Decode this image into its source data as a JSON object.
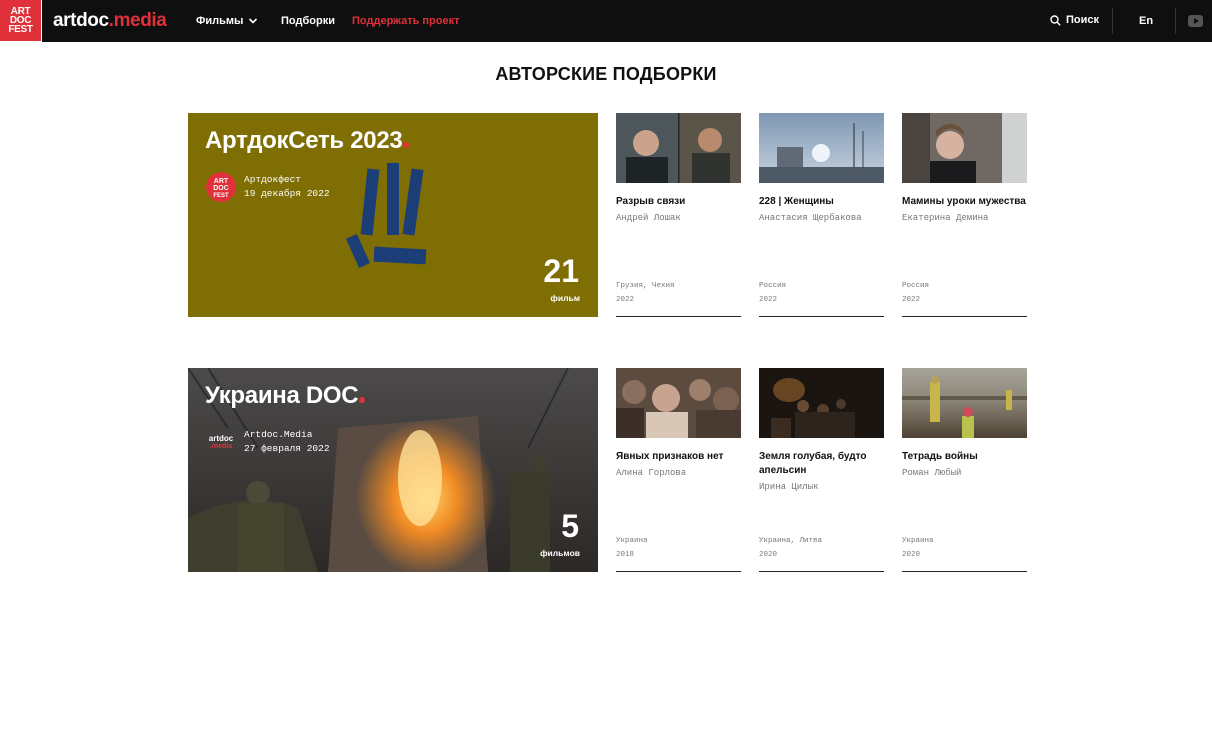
{
  "header": {
    "fest_logo": [
      "ART",
      "DOC",
      "FEST"
    ],
    "brand_main": "artdoc",
    "brand_dot": ".",
    "brand_media": "media",
    "nav": {
      "films": "Фильмы",
      "selections": "Подборки",
      "support": "Поддержать проект"
    },
    "search_label": "Поиск",
    "lang_label": "En",
    "accent_color": "#e0303a"
  },
  "page_title": "АВТОРСКИЕ ПОДБОРКИ",
  "collections": [
    {
      "title": "АртдокСеть 2023",
      "author": "Артдокфест",
      "date": "19 декабря 2022",
      "count": "21",
      "count_label": "фильм",
      "films": [
        {
          "title": "Разрыв связи",
          "author": "Андрей Лошак",
          "country": "Грузия, Чехия",
          "year": "2022"
        },
        {
          "title": "228 | Женщины",
          "author": "Анастасия Щербакова",
          "country": "Россия",
          "year": "2022"
        },
        {
          "title": "Мамины уроки мужества",
          "author": "Екатерина Демина",
          "country": "Россия",
          "year": "2022"
        }
      ]
    },
    {
      "title": "Украина DOC",
      "author": "Artdoc.Media",
      "date": "27 февраля 2022",
      "count": "5",
      "count_label": "фильмов",
      "films": [
        {
          "title": "Явных признаков нет",
          "author": "Алина Горлова",
          "country": "Украина",
          "year": "2018"
        },
        {
          "title": "Земля голубая, будто апельсин",
          "author": "Ирина Цилык",
          "country": "Украина, Литва",
          "year": "2020"
        },
        {
          "title": "Тетрадь войны",
          "author": "Роман Любый",
          "country": "Украина",
          "year": "2020"
        }
      ]
    }
  ]
}
